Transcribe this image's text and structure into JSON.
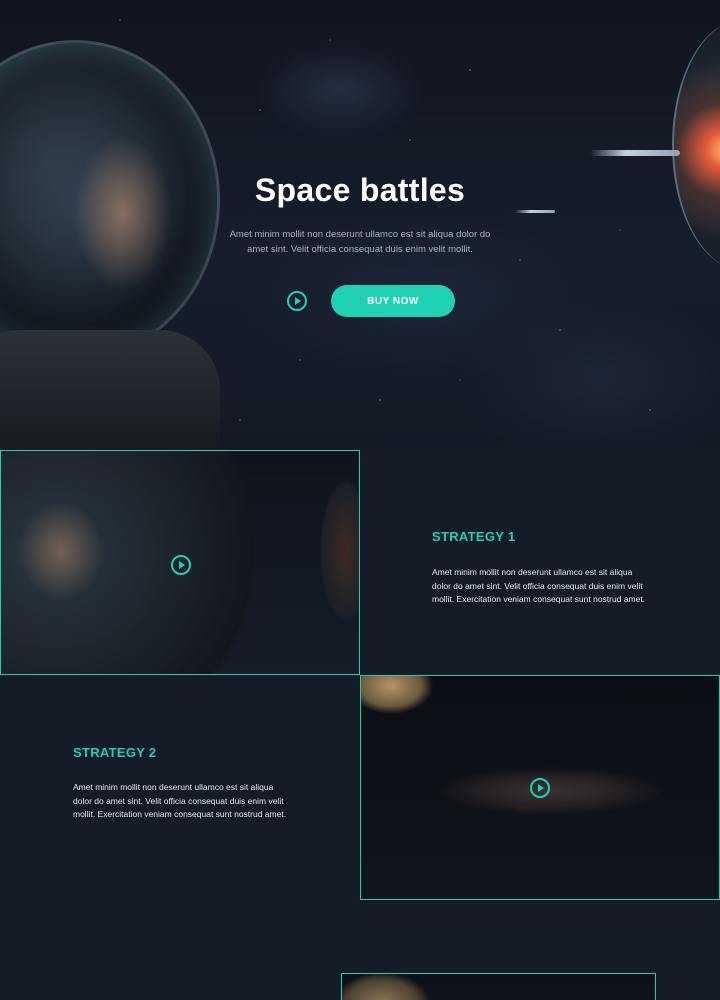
{
  "hero": {
    "title": "Space battles",
    "description": "Amet minim mollit non deserunt ullamco est sit aliqua dolor do amet sint. Velit officia consequat duis enim velit mollit.",
    "buy_label": "BUY NOW",
    "play_icon": "play-circle-icon",
    "accent": "#1ed2b3"
  },
  "strategies": [
    {
      "title": "STRATEGY 1",
      "text": "Amet minim mollit non deserunt ullamco est sit aliqua dolor do amet sint. Velit officia consequat duis enim velit mollit. Exercitation veniam consequat sunt nostrud amet."
    },
    {
      "title": "STRATEGY 2",
      "text": "Amet minim mollit non deserunt ullamco est sit aliqua dolor do amet sint. Velit officia consequat duis enim velit mollit. Exercitation veniam consequat sunt nostrud amet."
    }
  ],
  "colors": {
    "background": "#141c27",
    "accent": "#1fd1b4",
    "text_light": "#e3e8ef"
  }
}
